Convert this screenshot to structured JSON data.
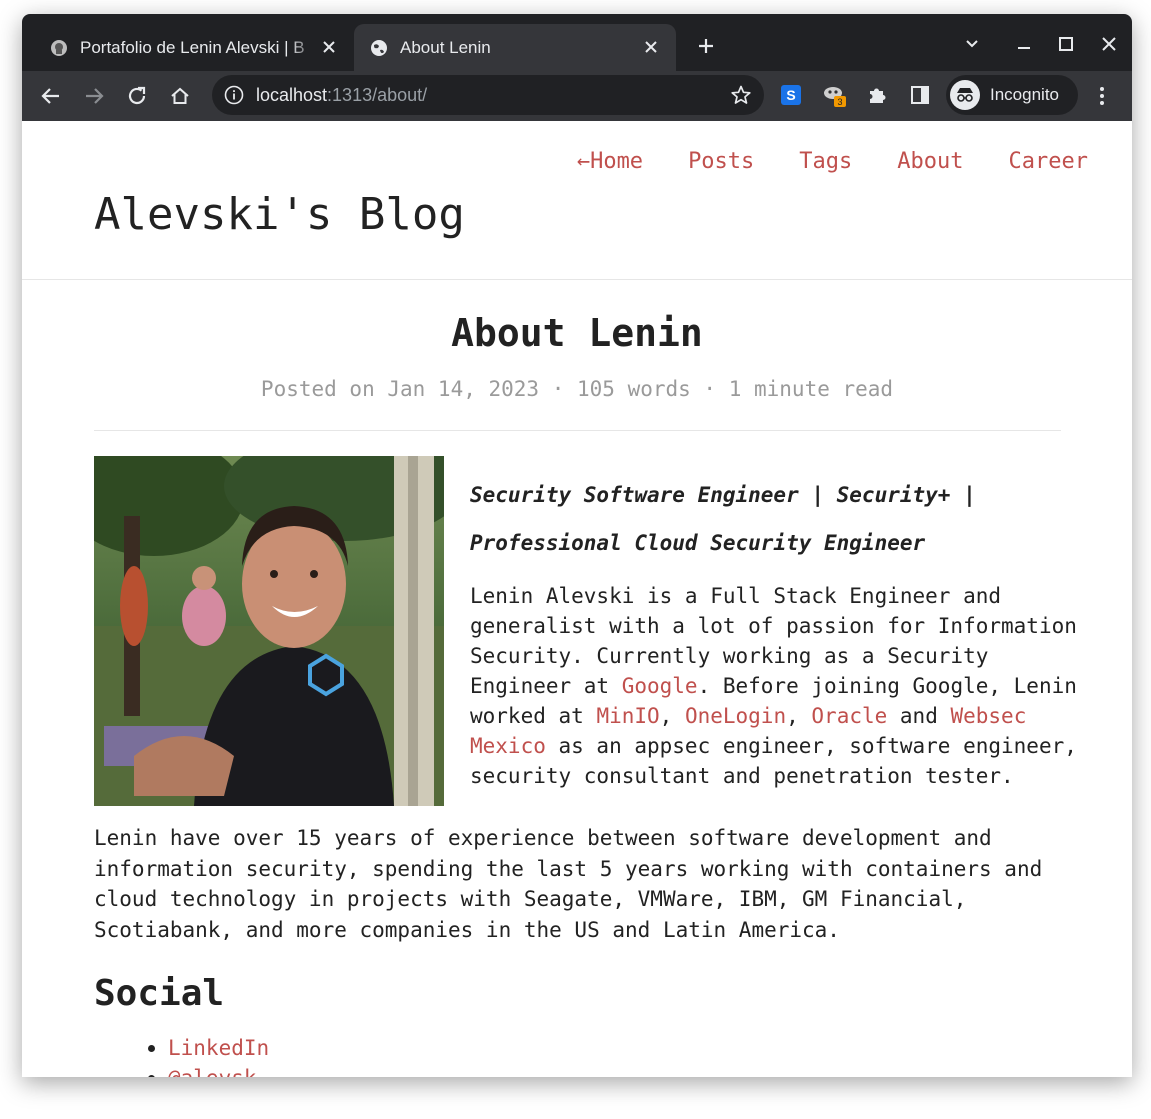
{
  "browser": {
    "tabs": [
      {
        "title": "Portafolio de Lenin Alevski | B",
        "active": false
      },
      {
        "title": "About Lenin",
        "active": true
      }
    ],
    "url_host": "localhost",
    "url_rest": ":1313/about/",
    "extension_badge": "3",
    "profile_label": "Incognito"
  },
  "site": {
    "nav": [
      "←Home",
      "Posts",
      "Tags",
      "About",
      "Career"
    ],
    "blog_title": "Alevski's Blog"
  },
  "post": {
    "title": "About Lenin",
    "meta": "Posted on Jan 14, 2023 · 105 words · 1 minute read",
    "role_line1": "Security Software Engineer | Security+ |",
    "role_line2": "Professional Cloud Security Engineer",
    "bio": {
      "t1": "Lenin Alevski is a Full Stack Engineer and generalist with a lot of passion for Information Security. Currently working as a Security Engineer at ",
      "link_google": "Google",
      "t2": ". Before joining Google, Lenin worked at ",
      "link_minio": "MinIO",
      "sep1": ", ",
      "link_onelogin": "OneLogin",
      "sep2": ", ",
      "link_oracle": "Oracle",
      "t3": " and ",
      "link_websec": "Websec Mexico",
      "t4": " as an appsec engineer, software engineer, security consultant and penetration tester."
    },
    "paragraph2": "Lenin have over 15 years of experience between software development and information security, spending the last 5 years working with containers and cloud technology in projects with Seagate, VMWare, IBM, GM Financial, Scotiabank, and more companies in the US and Latin America.",
    "social_heading": "Social",
    "social_links": [
      "LinkedIn",
      "@alevsk"
    ]
  },
  "colors": {
    "link": "#c0504d",
    "browser_frame": "#202124",
    "browser_toolbar": "#35363a"
  }
}
